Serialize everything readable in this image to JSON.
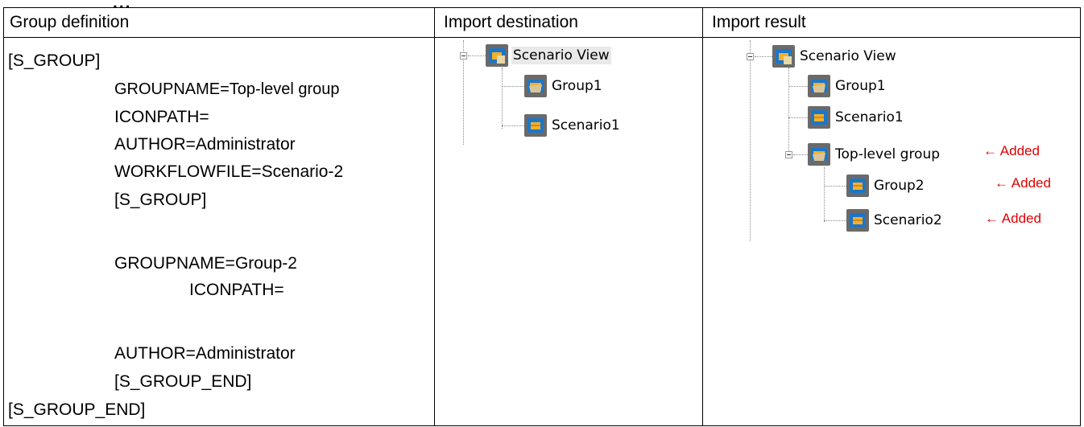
{
  "header_fragment": "...",
  "columns": {
    "definition": "Group definition",
    "destination": "Import destination",
    "result": "Import result"
  },
  "definition_lines": [
    "[S_GROUP]",
    "GROUPNAME=Top-level group",
    "ICONPATH=",
    "AUTHOR=Administrator",
    "WORKFLOWFILE=Scenario-2",
    "[S_GROUP]",
    "GROUPNAME=Group-2",
    "ICONPATH=",
    "AUTHOR=Administrator",
    "[S_GROUP_END]",
    "[S_GROUP_END]"
  ],
  "destination_tree": {
    "root": "Scenario View",
    "children": [
      "Group1",
      "Scenario1"
    ]
  },
  "result_tree": {
    "root": "Scenario View",
    "children": [
      "Group1",
      "Scenario1",
      "Top-level group"
    ],
    "grandchildren": [
      "Group2",
      "Scenario2"
    ]
  },
  "added_label": "← Added",
  "icons": {
    "group": "group-folder-icon",
    "scenario": "scenario-icon",
    "root": "scenario-view-icon"
  },
  "colors": {
    "added": "#e00000",
    "icon_bg": "#6a6a6a"
  }
}
